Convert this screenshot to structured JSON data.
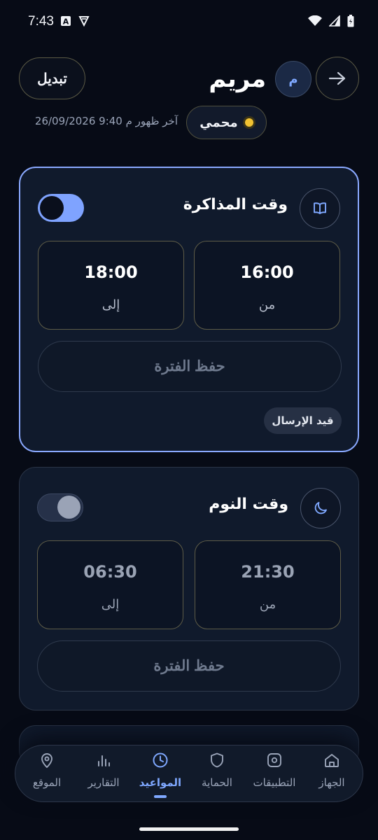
{
  "status_bar": {
    "time": "7:43"
  },
  "header": {
    "switch_label": "تبديل",
    "child_name": "مريم",
    "avatar_letter": "م",
    "status_label": "محمي",
    "last_seen": "آخر ظهور م 9:40 26/09/2026"
  },
  "schedules": [
    {
      "title": "وقت المذاكرة",
      "icon": "book-icon",
      "enabled": true,
      "from_value": "16:00",
      "from_label": "من",
      "to_value": "18:00",
      "to_label": "إلى",
      "save_label": "حفظ الفترة",
      "badge": "قيد الإرسال"
    },
    {
      "title": "وقت النوم",
      "icon": "moon-icon",
      "enabled": false,
      "from_value": "21:30",
      "from_label": "من",
      "to_value": "06:30",
      "to_label": "إلى",
      "save_label": "حفظ الفترة"
    }
  ],
  "nav": {
    "active": "المواعيد",
    "items": [
      {
        "label": "الجهاز",
        "icon": "home-icon"
      },
      {
        "label": "التطبيقات",
        "icon": "apps-icon"
      },
      {
        "label": "الحماية",
        "icon": "shield-icon"
      },
      {
        "label": "المواعيد",
        "icon": "clock-icon"
      },
      {
        "label": "التقارير",
        "icon": "chart-icon"
      },
      {
        "label": "الموقع",
        "icon": "location-icon"
      }
    ]
  },
  "colors": {
    "background": "#070b16",
    "card": "#101a2c",
    "accent": "#7fa8ff",
    "status_dot": "#f1c232"
  }
}
